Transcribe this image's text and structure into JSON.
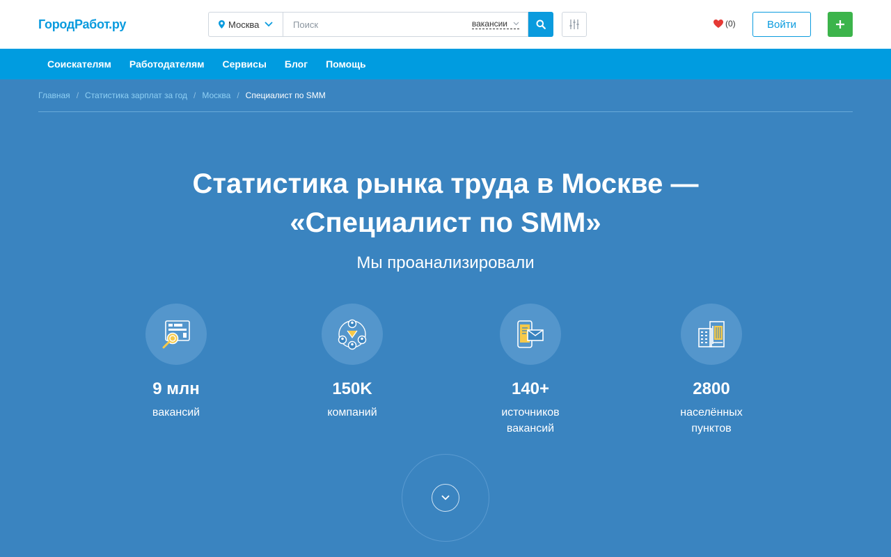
{
  "header": {
    "logo": "ГородРабот.ру",
    "city": "Москва",
    "search_placeholder": "Поиск",
    "search_type": "вакансии",
    "favorites_count": "(0)",
    "login_label": "Войти",
    "add_label": "+"
  },
  "nav": {
    "items": [
      "Соискателям",
      "Работодателям",
      "Сервисы",
      "Блог",
      "Помощь"
    ]
  },
  "breadcrumb": {
    "items": [
      "Главная",
      "Статистика зарплат за год",
      "Москва"
    ],
    "current": "Специалист по SMM",
    "separator": "/"
  },
  "hero": {
    "title_line1": "Статистика рынка труда в Москве —",
    "title_line2": "«Специалист по SMM»",
    "subtitle": "Мы проанализировали",
    "stats": [
      {
        "value": "9 млн",
        "label_line1": "вакансий",
        "label_line2": "",
        "icon": "vacancy-search-icon"
      },
      {
        "value": "150K",
        "label_line1": "компаний",
        "label_line2": "",
        "icon": "companies-network-icon"
      },
      {
        "value": "140+",
        "label_line1": "источников",
        "label_line2": "вакансий",
        "icon": "sources-phone-mail-icon"
      },
      {
        "value": "2800",
        "label_line1": "населённых",
        "label_line2": "пунктов",
        "icon": "buildings-icon"
      }
    ]
  },
  "colors": {
    "brand_blue": "#0a9bde",
    "nav_blue": "#009ce0",
    "hero_bg": "#3a84c0",
    "add_green": "#3cb44b",
    "heart_red": "#e53935"
  }
}
